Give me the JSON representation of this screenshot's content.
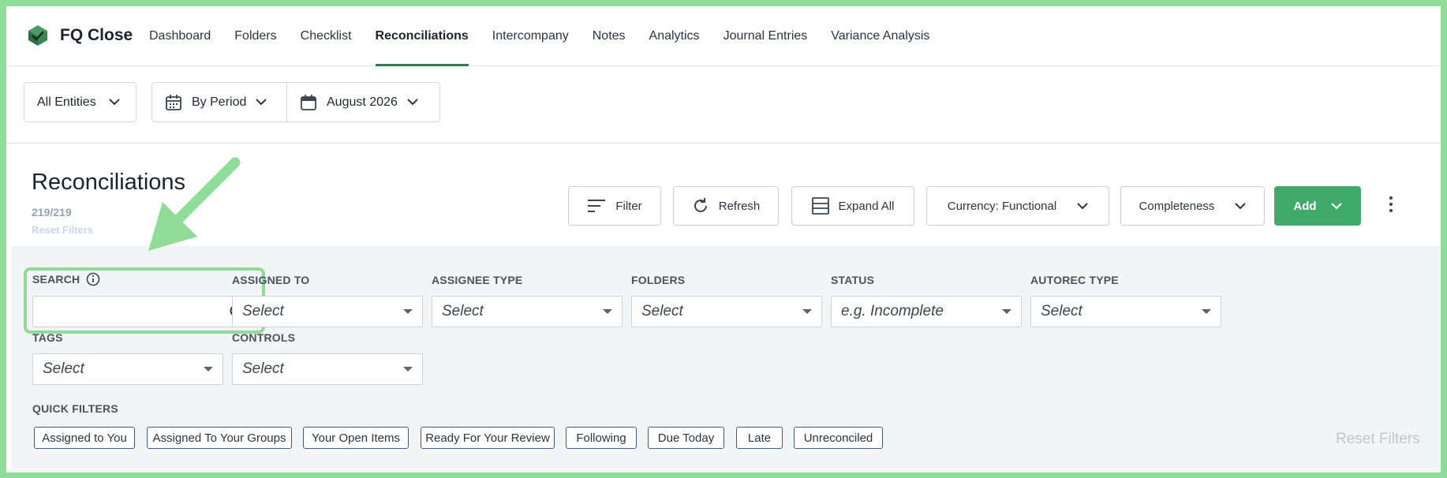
{
  "app": {
    "name": "FQ Close"
  },
  "nav": {
    "items": [
      {
        "label": "Dashboard"
      },
      {
        "label": "Folders"
      },
      {
        "label": "Checklist"
      },
      {
        "label": "Reconciliations",
        "active": true
      },
      {
        "label": "Intercompany"
      },
      {
        "label": "Notes"
      },
      {
        "label": "Analytics"
      },
      {
        "label": "Journal Entries"
      },
      {
        "label": "Variance Analysis"
      }
    ]
  },
  "filterbar": {
    "entities": "All Entities",
    "period_mode": "By Period",
    "period": "August 2026"
  },
  "header": {
    "title": "Reconciliations",
    "count": "219/219",
    "reset_filters": "Reset Filters"
  },
  "toolbar": {
    "filter": "Filter",
    "refresh": "Refresh",
    "expand_all": "Expand All",
    "currency": "Currency: Functional",
    "completeness": "Completeness",
    "add": "Add"
  },
  "filters": {
    "search_label": "SEARCH",
    "assigned_to": {
      "label": "ASSIGNED TO",
      "value": "Select"
    },
    "assignee_type": {
      "label": "ASSIGNEE TYPE",
      "value": "Select"
    },
    "folders": {
      "label": "FOLDERS",
      "value": "Select"
    },
    "status": {
      "label": "STATUS",
      "value": "e.g. Incomplete"
    },
    "autorec_type": {
      "label": "AUTOREC TYPE",
      "value": "Select"
    },
    "tags": {
      "label": "TAGS",
      "value": "Select"
    },
    "controls": {
      "label": "CONTROLS",
      "value": "Select"
    }
  },
  "quick_filters": {
    "label": "QUICK FILTERS",
    "chips": [
      "Assigned to You",
      "Assigned To Your Groups",
      "Your Open Items",
      "Ready For Your Review",
      "Following",
      "Due Today",
      "Late",
      "Unreconciled"
    ],
    "reset": "Reset Filters"
  },
  "colors": {
    "accent": "#3faa6a",
    "nav_underline": "#2f7a55",
    "annotation": "#8edc97"
  }
}
